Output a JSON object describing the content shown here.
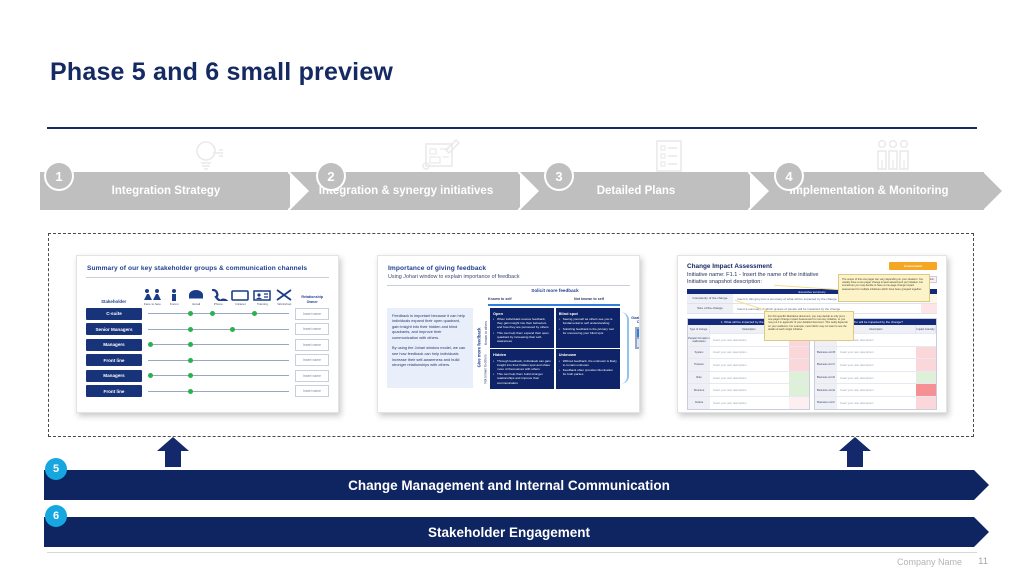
{
  "slide": {
    "title": "Phase 5 and 6 small preview",
    "footer_company": "Company Name",
    "footer_page": "11",
    "colors": {
      "navy": "#0f2562",
      "title_navy": "#152a63",
      "grey_chevron": "#bfbfbf",
      "cyan_badge": "#17a7e0",
      "green_dot": "#28b14c",
      "orange_badge": "#f5a623"
    }
  },
  "process": {
    "steps": [
      {
        "number": "1",
        "label": "Integration Strategy",
        "icon": "lightbulb-icon"
      },
      {
        "number": "2",
        "label": "Integration & synergy initiatives",
        "icon": "blueprint-icon"
      },
      {
        "number": "3",
        "label": "Detailed Plans",
        "icon": "checklist-icon"
      },
      {
        "number": "4",
        "label": "Implementation & Monitoring",
        "icon": "people-group-icon"
      }
    ]
  },
  "cards": {
    "stakeholder": {
      "title": "Summary of our key stakeholder groups & communication channels",
      "label_col_header": "Stakeholder",
      "relationship_col_header": "Relationship Owner",
      "channels": [
        {
          "label": "Face to face",
          "icon": "face-to-face-icon"
        },
        {
          "label": "Forum",
          "icon": "person-icon"
        },
        {
          "label": "Email",
          "icon": "email-icon"
        },
        {
          "label": "Phone",
          "icon": "phone-icon"
        },
        {
          "label": "Intranet",
          "icon": "screen-icon"
        },
        {
          "label": "Training",
          "icon": "training-icon"
        },
        {
          "label": "Workshop",
          "icon": "workshop-icon"
        }
      ],
      "rows": [
        {
          "name": "C-suite",
          "dots": [
            2,
            3,
            5
          ],
          "owner": "Insert name"
        },
        {
          "name": "Senior Managers",
          "dots": [
            2,
            4
          ],
          "owner": "Insert name"
        },
        {
          "name": "Managers",
          "dots": [
            0,
            2
          ],
          "owner": "Insert name"
        },
        {
          "name": "Front line",
          "dots": [
            2
          ],
          "owner": "Insert name"
        },
        {
          "name": "Managers",
          "dots": [
            0,
            2
          ],
          "owner": "Insert name"
        },
        {
          "name": "Front line",
          "dots": [
            2
          ],
          "owner": "Insert name"
        }
      ]
    },
    "johari": {
      "title": "Importance of giving feedback",
      "subtitle": "Using Johari window to explain importance of feedback",
      "intro_p1": "Feedback is important because it can help individuals expand their open quadrant, gain insight into their hidden and blind quadrants, and improve their communication with others.",
      "intro_p2": "By using the Johari window model, we can see how feedback can help individuals increase their self-awareness and build stronger relationships with others.",
      "top_axis_label": "Solicit more feedback",
      "col_left": "Known to self",
      "col_right": "Not known to self",
      "left_axis_label": "Give more feedback",
      "row_top": "Known to others",
      "row_bottom": "Not known to others",
      "goal_label": "Goal - Extend the Open Spot",
      "quadrants": [
        {
          "name": "Open",
          "bullets": [
            "When individuals receive feedback, they gain insight into their behaviors and how they are perceived by others",
            "This can help them expand their open quadrant by increasing their self-awareness"
          ]
        },
        {
          "name": "Blind spot",
          "bullets": [
            "Seeing yourself as others see you is fundamental to self understanding",
            "Soliciting feedback is the primary tool for uncovering your blind spot"
          ]
        },
        {
          "name": "Hidden",
          "bullets": [
            "Through feedback, individuals can gain insight into their hidden spot and share more of themselves with others",
            "This can help them build stronger relationships and improve their communication"
          ]
        },
        {
          "name": "Unknown",
          "bullets": [
            "Without feedback, the unknown is likely to remain unknown",
            "Feedback often provides illumination for both parties"
          ]
        }
      ]
    },
    "change_impact": {
      "title": "Change Impact Assessment",
      "line_1": "Initiative name: F1.1 - Insert the name of the initiative",
      "line_2": "Initiative snapshot description:",
      "badge": "Assessment",
      "legend": [
        "Complete",
        "Draft",
        "Incomplete",
        "Initiated",
        "High",
        "Medium"
      ],
      "exec_summary_header": "Executive summary",
      "summary_rows": [
        {
          "key": "Complexity of the change",
          "value": "Insert in this grey box a summary of what will be impacted by the change"
        },
        {
          "key": "Size of the change",
          "value": "Insert a summary of which groups of people will be impacted by the change"
        }
      ],
      "table_left": {
        "header": "1. What will be impacted by the change?",
        "col_type": "Type of change",
        "col_desc": "Description",
        "col_impact": "Impact intensity",
        "rows": [
          {
            "type": "People/ formation / reallocation",
            "desc": "Insert your own description",
            "impact": "pink"
          },
          {
            "type": "System",
            "desc": "Insert your own description",
            "impact": "pink"
          },
          {
            "type": "Process",
            "desc": "Insert your own description",
            "impact": "pink"
          },
          {
            "type": "Role",
            "desc": "Insert your own description",
            "impact": "green"
          },
          {
            "type": "Structure",
            "desc": "Insert your own description",
            "impact": "green"
          },
          {
            "type": "Culture",
            "desc": "Insert your own description",
            "impact": "lpink"
          }
        ]
      },
      "table_right": {
        "header": "2. Who will be impacted by the change?",
        "col_type": "Business unit",
        "col_desc": "Description",
        "col_impact": "Impact intensity",
        "rows": [
          {
            "type": "Business unit A",
            "desc": "Insert your own description",
            "impact": "white"
          },
          {
            "type": "Business unit B",
            "desc": "Insert your own description",
            "impact": "pink"
          },
          {
            "type": "Business unit C",
            "desc": "Insert your own description",
            "impact": "pink"
          },
          {
            "type": "Business unit D",
            "desc": "Insert your own description",
            "impact": "green"
          },
          {
            "type": "Business unit E",
            "desc": "Insert your own description",
            "impact": "red"
          },
          {
            "type": "Business unit F",
            "desc": "Insert your own description",
            "impact": "pink"
          }
        ]
      },
      "callout_1": "The scope of this one pager can vary depending on your situation. You usually have a one-pager change impact assessment per initiative, but sometimes you may decide to have a one-page change impact assessment for multiple initiatives which have been grouped together.",
      "callout_2": "For this specific illustrative document, you may decide to only put a one-pager Change Impact Assessment for one key initiative, or you may put it in appendix of your detailed document. This really depends on your audience. For example, most CEOs may not want to see the details of each single initiative."
    }
  },
  "banners": [
    {
      "number": "5",
      "label": "Change Management and Internal Communication"
    },
    {
      "number": "6",
      "label": "Stakeholder Engagement"
    }
  ]
}
